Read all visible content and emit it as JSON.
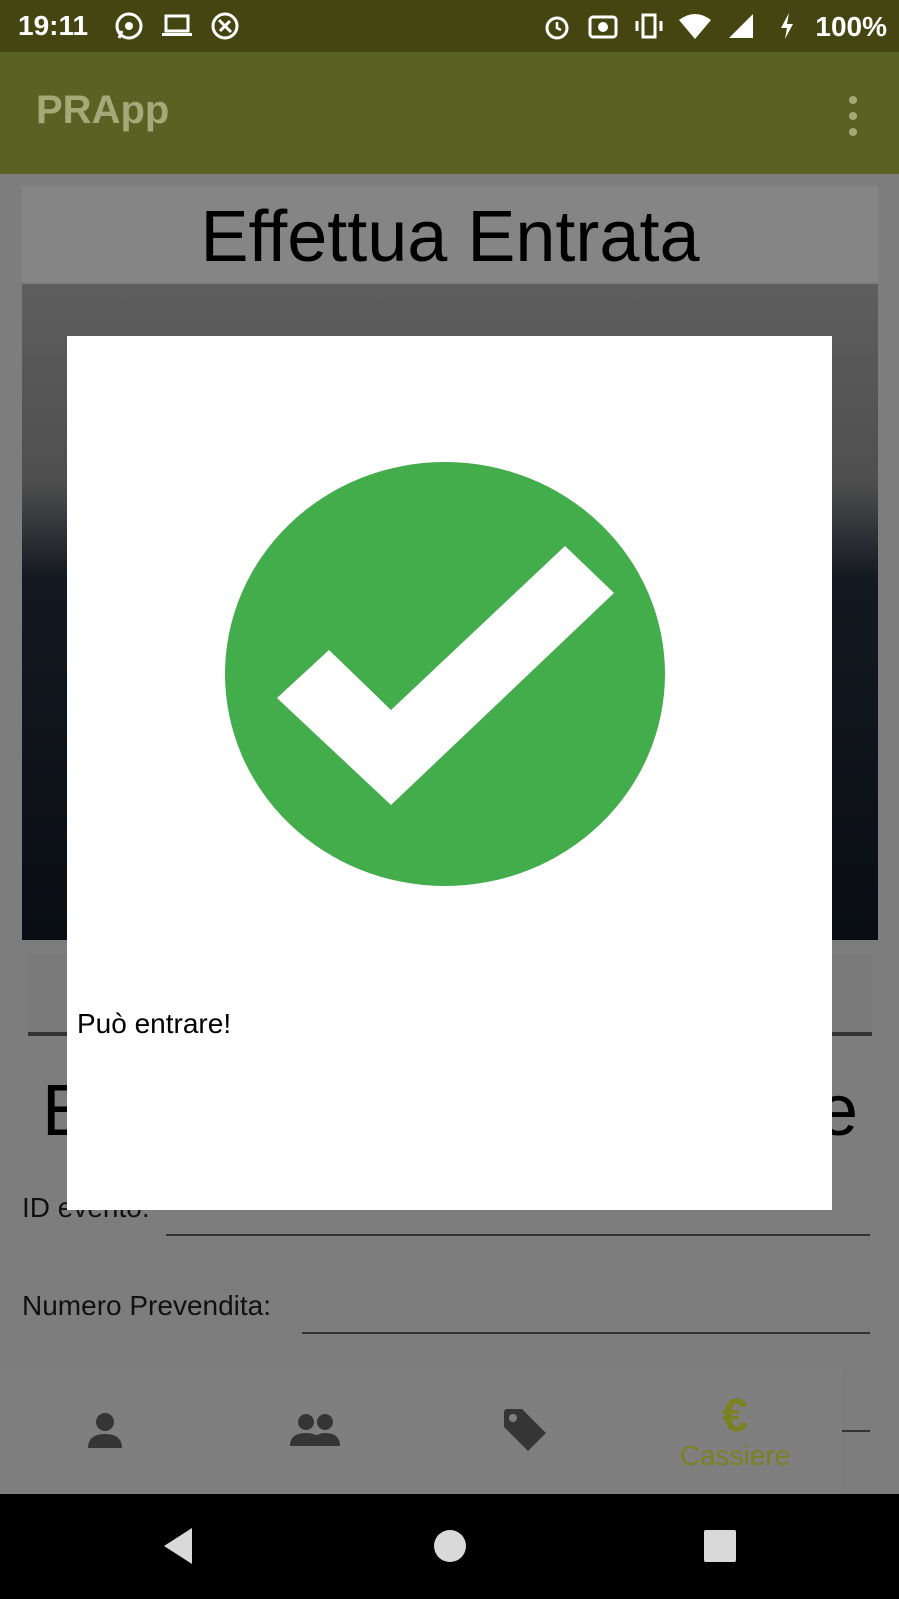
{
  "status_bar": {
    "time": "19:11",
    "battery": "100%",
    "left_icons": [
      "whatsapp-icon",
      "laptop-icon",
      "sync-icon"
    ],
    "right_icons": [
      "alarm-icon",
      "screenshot-icon",
      "vibrate-icon",
      "wifi-icon",
      "signal-icon",
      "charging-icon"
    ]
  },
  "app_bar": {
    "title": "PRApp"
  },
  "page": {
    "section_title": "Effettua Entrata",
    "second_title_left": "E",
    "second_title_right": "e",
    "fields": {
      "event_id_label": "ID evento:",
      "presale_number_label": "Numero Prevendita:"
    }
  },
  "bottom_nav": {
    "items": [
      {
        "icon": "person-icon"
      },
      {
        "icon": "group-icon"
      },
      {
        "icon": "tag-icon"
      },
      {
        "icon": "euro-icon",
        "label": "Cassiere",
        "active": true
      }
    ]
  },
  "dialog": {
    "message": "Può entrare!",
    "icon": "check-circle-icon",
    "icon_color": "#43ac4b"
  },
  "colors": {
    "status_bar": "#454511",
    "app_bar": "#5a6223",
    "accent": "#7c8120"
  }
}
